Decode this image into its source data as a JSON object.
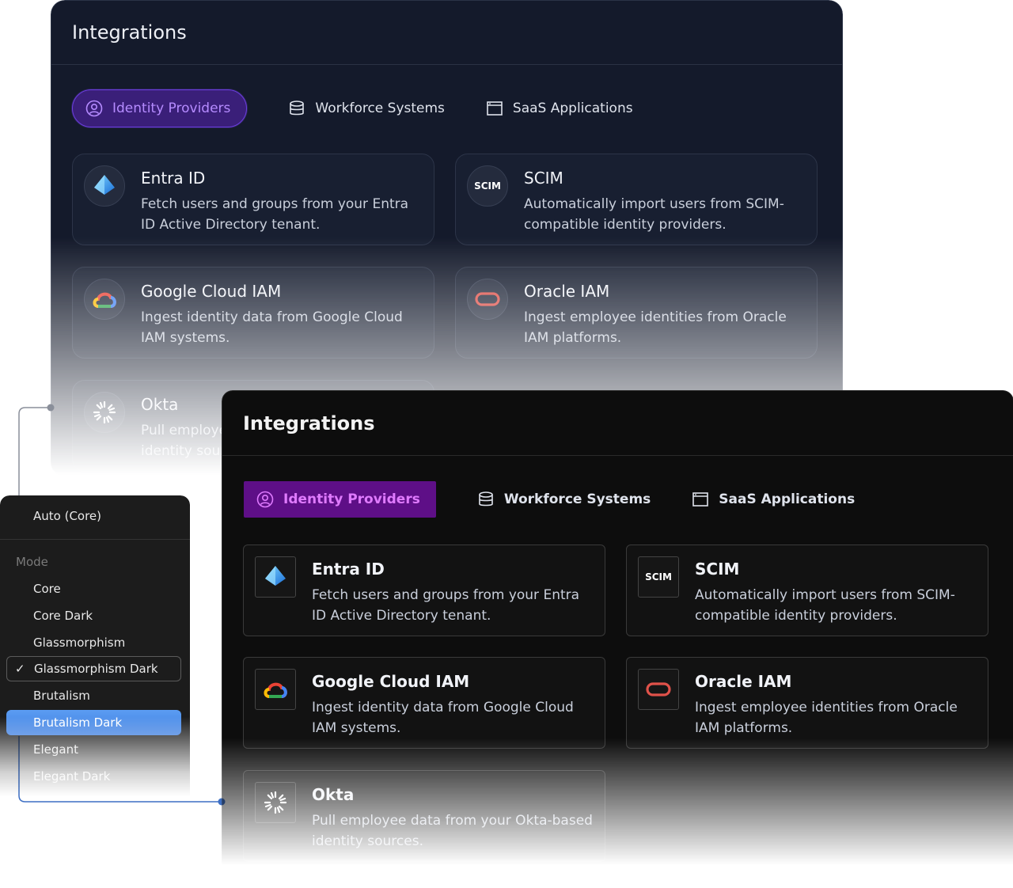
{
  "back_panel": {
    "title": "Integrations",
    "tabs": [
      {
        "label": "Identity Providers",
        "icon": "user-circle-icon",
        "active": true
      },
      {
        "label": "Workforce Systems",
        "icon": "database-icon",
        "active": false
      },
      {
        "label": "SaaS Applications",
        "icon": "browser-window-icon",
        "active": false
      }
    ],
    "cards": [
      {
        "title": "Entra ID",
        "description": "Fetch users and groups from your Entra ID Active Directory tenant.",
        "icon": "entra-id-icon"
      },
      {
        "title": "SCIM",
        "description": "Automatically import users from SCIM-compatible identity providers.",
        "icon": "scim-icon",
        "icon_text": "SCIM"
      },
      {
        "title": "Google Cloud IAM",
        "description": "Ingest identity data from Google Cloud IAM systems.",
        "icon": "google-cloud-icon"
      },
      {
        "title": "Oracle IAM",
        "description": "Ingest employee identities from Oracle IAM platforms.",
        "icon": "oracle-icon"
      },
      {
        "title": "Okta",
        "description": "Pull employee data from your Okta-based identity sources.",
        "icon": "okta-icon"
      }
    ]
  },
  "dropdown": {
    "current": "Auto (Core)",
    "section_label": "Mode",
    "options": [
      {
        "label": "Core"
      },
      {
        "label": "Core Dark"
      },
      {
        "label": "Glassmorphism"
      },
      {
        "label": "Glassmorphism Dark",
        "checked": true
      },
      {
        "label": "Brutalism"
      },
      {
        "label": "Brutalism Dark",
        "highlighted": true
      },
      {
        "label": "Elegant"
      },
      {
        "label": "Elegant Dark"
      }
    ],
    "check_glyph": "✓"
  },
  "front_panel": {
    "title": "Integrations",
    "tabs": [
      {
        "label": "Identity Providers",
        "icon": "user-circle-icon",
        "active": true
      },
      {
        "label": "Workforce Systems",
        "icon": "database-icon",
        "active": false
      },
      {
        "label": "SaaS Applications",
        "icon": "browser-window-icon",
        "active": false
      }
    ],
    "cards": [
      {
        "title": "Entra ID",
        "description": "Fetch users and groups from your Entra ID Active Directory tenant.",
        "icon": "entra-id-icon"
      },
      {
        "title": "SCIM",
        "description": "Automatically import users from SCIM-compatible identity providers.",
        "icon": "scim-icon",
        "icon_text": "SCIM"
      },
      {
        "title": "Google Cloud IAM",
        "description": "Ingest identity data from Google Cloud IAM systems.",
        "icon": "google-cloud-icon"
      },
      {
        "title": "Oracle IAM",
        "description": "Ingest employee identities from Oracle IAM platforms.",
        "icon": "oracle-icon"
      },
      {
        "title": "Okta",
        "description": "Pull employee data from your Okta-based identity sources.",
        "icon": "okta-icon"
      }
    ]
  },
  "colors": {
    "back_active_tab": "#3a1f79",
    "front_active_tab": "#5e0f87",
    "highlight": "#4a8aea",
    "connector": "#3d6fc4"
  }
}
